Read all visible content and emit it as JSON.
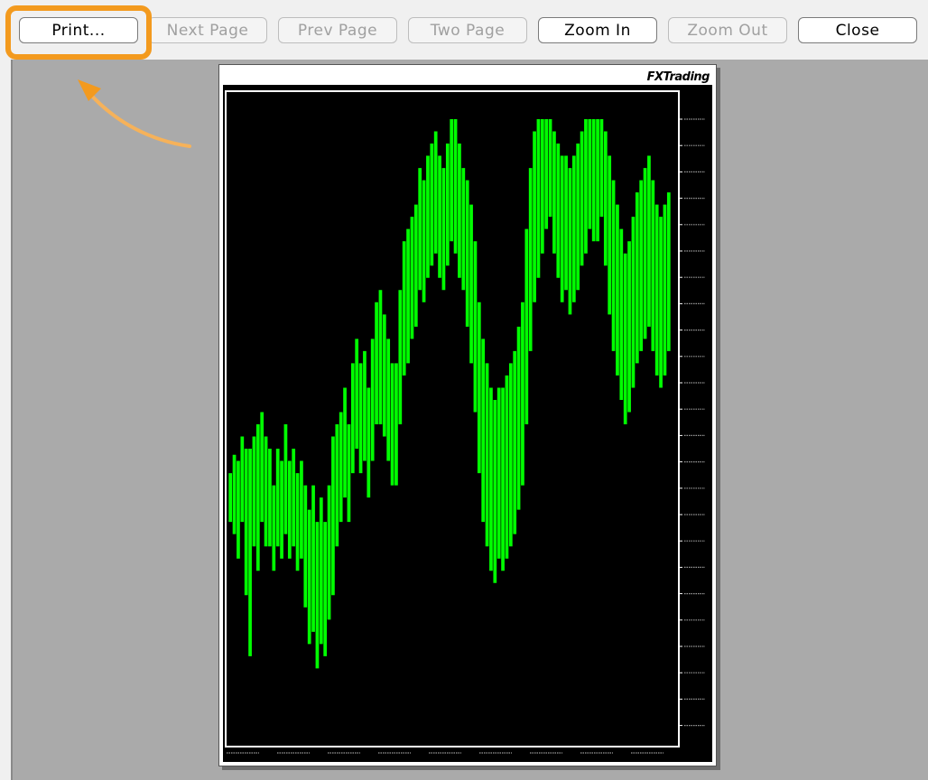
{
  "toolbar": {
    "buttons": [
      {
        "key": "print",
        "label": "Print...",
        "enabled": true
      },
      {
        "key": "next_page",
        "label": "Next Page",
        "enabled": false
      },
      {
        "key": "prev_page",
        "label": "Prev Page",
        "enabled": false
      },
      {
        "key": "two_page",
        "label": "Two Page",
        "enabled": false
      },
      {
        "key": "zoom_in",
        "label": "Zoom In",
        "enabled": true
      },
      {
        "key": "zoom_out",
        "label": "Zoom Out",
        "enabled": false
      },
      {
        "key": "close",
        "label": "Close",
        "enabled": true
      }
    ]
  },
  "highlight": {
    "target": "print",
    "color": "#f39a1e"
  },
  "page": {
    "header_text": "",
    "brand": "FXTrading",
    "symbol_label": ""
  },
  "colors": {
    "preview_background": "#aaaaaa",
    "chart_background": "#000000",
    "series": "#00ff00",
    "highlight": "#f39a1e"
  },
  "chart_data": {
    "type": "bar",
    "title": "",
    "xlabel": "",
    "ylabel": "",
    "ylim": [
      0,
      100
    ],
    "grid": false,
    "series": [
      {
        "values": [
          38,
          40,
          36,
          42,
          35,
          28,
          41,
          37,
          44,
          40,
          39,
          33,
          38,
          36,
          42,
          37,
          39,
          34,
          36,
          30,
          27,
          31,
          24,
          29,
          22,
          26,
          33,
          40,
          44,
          49,
          42,
          53,
          58,
          52,
          55,
          48,
          57,
          61,
          64,
          60,
          56,
          52,
          50,
          62,
          70,
          72,
          76,
          78,
          84,
          82,
          86,
          88,
          90,
          85,
          83,
          89,
          92,
          91,
          87,
          84,
          80,
          75,
          67,
          58,
          52,
          48,
          44,
          42,
          44,
          43,
          45,
          47,
          49,
          52,
          56,
          66,
          78,
          86,
          90,
          93,
          95,
          97,
          92,
          88,
          85,
          86,
          82,
          84,
          87,
          90,
          92,
          95,
          93,
          94,
          96,
          89,
          83,
          78,
          74,
          70,
          66,
          68,
          72,
          76,
          78,
          80,
          82,
          79,
          75,
          72,
          74,
          77
        ],
        "ranges": [
          [
            34,
            42
          ],
          [
            32,
            45
          ],
          [
            28,
            44
          ],
          [
            34,
            48
          ],
          [
            22,
            46
          ],
          [
            12,
            46
          ],
          [
            30,
            48
          ],
          [
            26,
            50
          ],
          [
            34,
            52
          ],
          [
            30,
            48
          ],
          [
            30,
            46
          ],
          [
            26,
            40
          ],
          [
            30,
            46
          ],
          [
            28,
            44
          ],
          [
            32,
            50
          ],
          [
            28,
            44
          ],
          [
            30,
            46
          ],
          [
            26,
            42
          ],
          [
            28,
            44
          ],
          [
            20,
            40
          ],
          [
            14,
            36
          ],
          [
            16,
            40
          ],
          [
            10,
            34
          ],
          [
            14,
            38
          ],
          [
            12,
            34
          ],
          [
            18,
            40
          ],
          [
            22,
            48
          ],
          [
            30,
            50
          ],
          [
            34,
            52
          ],
          [
            38,
            56
          ],
          [
            34,
            50
          ],
          [
            42,
            60
          ],
          [
            46,
            64
          ],
          [
            42,
            60
          ],
          [
            44,
            62
          ],
          [
            38,
            56
          ],
          [
            44,
            64
          ],
          [
            50,
            70
          ],
          [
            50,
            72
          ],
          [
            48,
            68
          ],
          [
            44,
            64
          ],
          [
            40,
            60
          ],
          [
            40,
            60
          ],
          [
            50,
            72
          ],
          [
            58,
            80
          ],
          [
            60,
            82
          ],
          [
            64,
            84
          ],
          [
            66,
            86
          ],
          [
            72,
            92
          ],
          [
            70,
            90
          ],
          [
            74,
            94
          ],
          [
            76,
            96
          ],
          [
            78,
            98
          ],
          [
            74,
            94
          ],
          [
            72,
            92
          ],
          [
            76,
            96
          ],
          [
            80,
            100
          ],
          [
            78,
            100
          ],
          [
            74,
            96
          ],
          [
            72,
            92
          ],
          [
            66,
            90
          ],
          [
            60,
            86
          ],
          [
            52,
            80
          ],
          [
            42,
            70
          ],
          [
            34,
            64
          ],
          [
            30,
            60
          ],
          [
            26,
            56
          ],
          [
            24,
            54
          ],
          [
            28,
            56
          ],
          [
            26,
            56
          ],
          [
            28,
            58
          ],
          [
            30,
            60
          ],
          [
            32,
            62
          ],
          [
            36,
            66
          ],
          [
            40,
            70
          ],
          [
            50,
            82
          ],
          [
            62,
            92
          ],
          [
            70,
            98
          ],
          [
            74,
            100
          ],
          [
            78,
            100
          ],
          [
            82,
            100
          ],
          [
            84,
            100
          ],
          [
            78,
            98
          ],
          [
            74,
            96
          ],
          [
            70,
            94
          ],
          [
            72,
            94
          ],
          [
            68,
            92
          ],
          [
            70,
            94
          ],
          [
            72,
            96
          ],
          [
            76,
            98
          ],
          [
            78,
            100
          ],
          [
            82,
            100
          ],
          [
            80,
            100
          ],
          [
            80,
            100
          ],
          [
            84,
            100
          ],
          [
            76,
            98
          ],
          [
            68,
            94
          ],
          [
            62,
            90
          ],
          [
            58,
            86
          ],
          [
            54,
            82
          ],
          [
            50,
            78
          ],
          [
            52,
            80
          ],
          [
            56,
            84
          ],
          [
            60,
            88
          ],
          [
            62,
            90
          ],
          [
            64,
            92
          ],
          [
            66,
            94
          ],
          [
            62,
            90
          ],
          [
            58,
            86
          ],
          [
            56,
            84
          ],
          [
            58,
            86
          ],
          [
            62,
            88
          ]
        ]
      }
    ]
  }
}
